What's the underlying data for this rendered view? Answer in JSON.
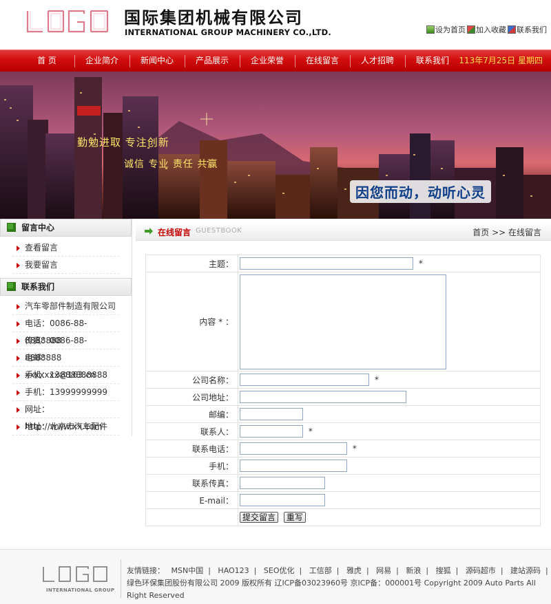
{
  "header": {
    "logo_text": "LOGO",
    "company_cn": "国际集团机械有限公司",
    "company_en": "INTERNATIONAL GROUP MACHINERY CO.,LTD.",
    "top_links": [
      {
        "label": "设为首页",
        "icon": "home-icon"
      },
      {
        "label": "加入收藏",
        "icon": "bookmark-icon"
      },
      {
        "label": "联系我们",
        "icon": "contact-icon"
      }
    ]
  },
  "nav": {
    "items": [
      "首 页",
      "企业简介",
      "新闻中心",
      "产品展示",
      "企业荣誉",
      "在线留言",
      "人才招聘",
      "联系我们"
    ],
    "date": "113年7月25日 星期四"
  },
  "banner": {
    "slogan1": "勤勉进取 专注创新",
    "slogan2": "诚信 专业 责任 共赢",
    "slogan3": "因您而动，动听心灵"
  },
  "sidebar": {
    "msg_title": "留言中心",
    "msg_items": [
      "查看留言",
      "我要留言"
    ],
    "contact_title": "联系我们",
    "contact_items": [
      "汽车零部件制造有限公司",
      "电话：0086-88-8888888",
      "传真：0086-88-8888888",
      "电邮：xxxxxxx@163.cn",
      "手机：13888888888",
      "手机：13999999999",
      "网址：http://www.xx.com",
      "地址：北京市汽车配件"
    ]
  },
  "main": {
    "title": "在线留言",
    "title_en": "GUESTBOOK",
    "breadcrumb": "首页 >> 在线留言",
    "form": {
      "subject_label": "主题：",
      "content_label": "内容 * ：",
      "company_label": "公司名称：",
      "address_label": "公司地址：",
      "zip_label": "邮编：",
      "contact_label": "联系人：",
      "phone_label": "联系电话：",
      "mobile_label": "手机：",
      "fax_label": "联系传真：",
      "email_label": "E-mail：",
      "required_mark": "*",
      "submit_label": "提交留言",
      "reset_label": "重写"
    }
  },
  "footer": {
    "logo_text": "LOGO",
    "logo_sub": "INTERNATIONAL GROUP",
    "links_label": "友情链接：",
    "links": [
      "MSN中国",
      "HAO123",
      "SEO优化",
      "工信部",
      "雅虎",
      "网易",
      "新浪",
      "搜狐",
      "源码超市",
      "建站源码"
    ],
    "copyright": "绿色环保集团股份有限公司 2009 版权所有 辽ICP备03023960号 京ICP备：000001号 Copyright 2009 Auto Parts All Right Reserved"
  },
  "colors": {
    "brand_red": "#d20c0c",
    "nav_date": "#ffe24a",
    "accent_green": "#4aa32c"
  }
}
